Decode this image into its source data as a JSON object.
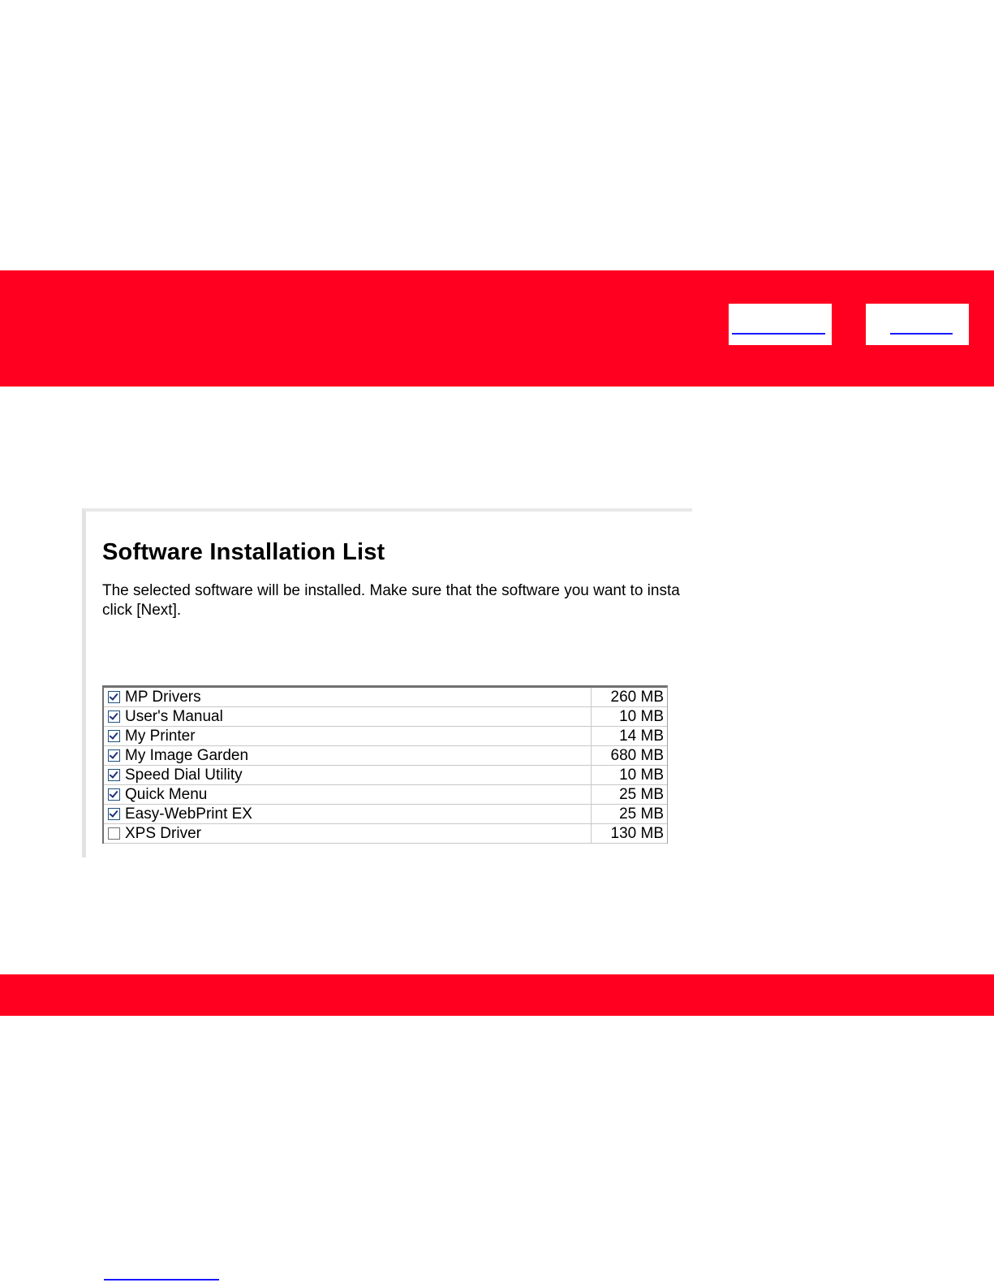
{
  "dialog": {
    "title": "Software Installation List",
    "description_line1": "The selected software will be installed. Make sure that the software you want to insta",
    "description_line2": "click [Next]."
  },
  "software_list": [
    {
      "name": "MP Drivers",
      "size": "260 MB",
      "checked": true
    },
    {
      "name": "User's Manual",
      "size": "10 MB",
      "checked": true
    },
    {
      "name": "My Printer",
      "size": "14 MB",
      "checked": true
    },
    {
      "name": "My Image Garden",
      "size": "680 MB",
      "checked": true
    },
    {
      "name": "Speed Dial Utility",
      "size": "10 MB",
      "checked": true
    },
    {
      "name": "Quick Menu",
      "size": "25 MB",
      "checked": true
    },
    {
      "name": "Easy-WebPrint EX",
      "size": "25 MB",
      "checked": true
    },
    {
      "name": "XPS Driver",
      "size": "130 MB",
      "checked": false
    }
  ],
  "colors": {
    "brand_red": "#ff0020",
    "link_blue": "#1a1aff",
    "checkmark": "#21307c"
  }
}
